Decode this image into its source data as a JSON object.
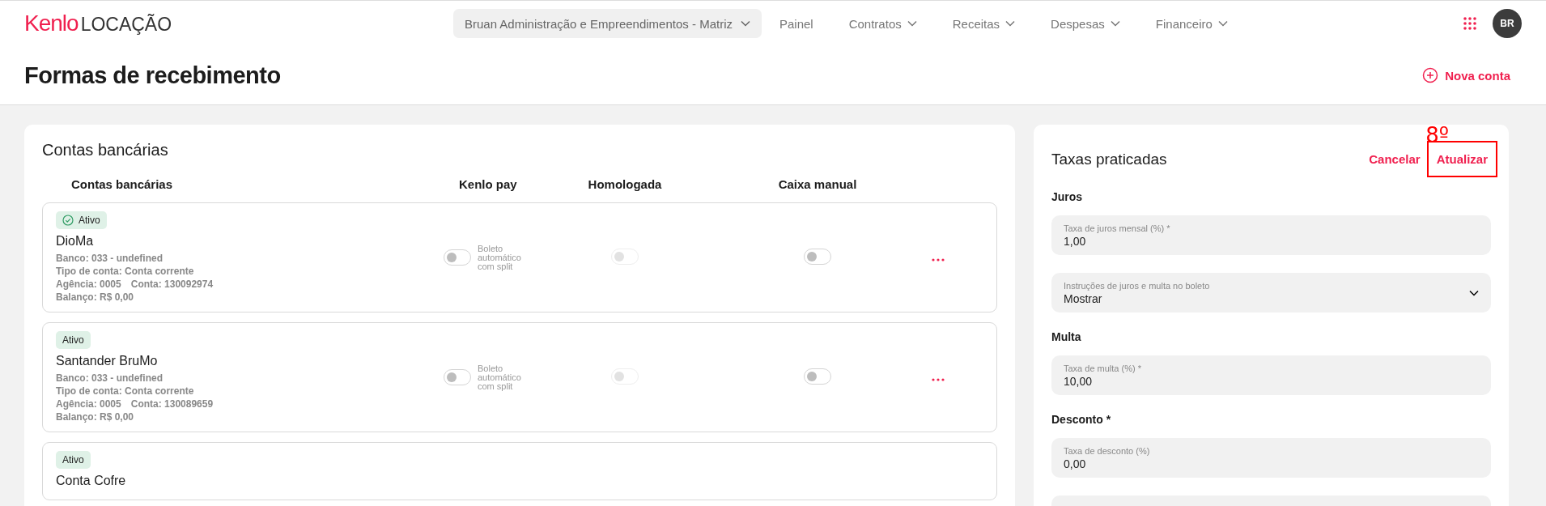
{
  "header": {
    "logo": {
      "brand": "Kenlo",
      "product": "LOCAÇÃO"
    },
    "company_selector": "Bruan Administração e Empreendimentos - Matriz",
    "nav": [
      {
        "label": "Painel",
        "dropdown": false
      },
      {
        "label": "Contratos",
        "dropdown": true
      },
      {
        "label": "Receitas",
        "dropdown": true
      },
      {
        "label": "Despesas",
        "dropdown": true
      },
      {
        "label": "Financeiro",
        "dropdown": true
      }
    ],
    "avatar": "BR"
  },
  "page": {
    "title": "Formas de recebimento",
    "action": "Nova conta"
  },
  "accounts": {
    "title": "Contas bancárias",
    "columns": [
      "Contas bancárias",
      "Kenlo pay",
      "Homologada",
      "Caixa manual"
    ],
    "rows": [
      {
        "status": "Ativo",
        "status_icon": true,
        "name": "DioMa",
        "details": [
          [
            "Banco: 033 - undefined"
          ],
          [
            "Tipo de conta: Conta corrente"
          ],
          [
            "Agência: 0005",
            "Conta: 130092974"
          ],
          [
            "Balanço: R$ 0,00"
          ]
        ],
        "kenlo_pay": {
          "on": false,
          "label": "Boleto automático com split"
        },
        "homologada": {
          "on": false,
          "disabled": true
        },
        "caixa_manual": {
          "on": false,
          "disabled": false
        }
      },
      {
        "status": "Ativo",
        "status_icon": false,
        "name": "Santander BruMo",
        "details": [
          [
            "Banco: 033 - undefined"
          ],
          [
            "Tipo de conta: Conta corrente"
          ],
          [
            "Agência: 0005",
            "Conta: 130089659"
          ],
          [
            "Balanço: R$ 0,00"
          ]
        ],
        "kenlo_pay": {
          "on": false,
          "label": "Boleto automático com split"
        },
        "homologada": {
          "on": false,
          "disabled": true
        },
        "caixa_manual": {
          "on": false,
          "disabled": false
        }
      },
      {
        "status": "Ativo",
        "status_icon": false,
        "name": "Conta Cofre"
      }
    ]
  },
  "rates": {
    "title": "Taxas praticadas",
    "annotation": "8º",
    "actions": [
      {
        "label": "Cancelar",
        "highlighted": false
      },
      {
        "label": "Atualizar",
        "highlighted": true
      }
    ],
    "items": [
      {
        "kind": "heading",
        "text": "Juros"
      },
      {
        "kind": "input",
        "label": "Taxa de juros mensal (%) *",
        "value": "1,00"
      },
      {
        "kind": "select",
        "label": "Instruções de juros e multa no boleto",
        "value": "Mostrar"
      },
      {
        "kind": "heading",
        "text": "Multa"
      },
      {
        "kind": "input",
        "label": "Taxa de multa (%) *",
        "value": "10,00"
      },
      {
        "kind": "heading",
        "text": "Desconto *"
      },
      {
        "kind": "input",
        "label": "Taxa de desconto (%)",
        "value": "0,00"
      },
      {
        "kind": "input"
      }
    ]
  }
}
